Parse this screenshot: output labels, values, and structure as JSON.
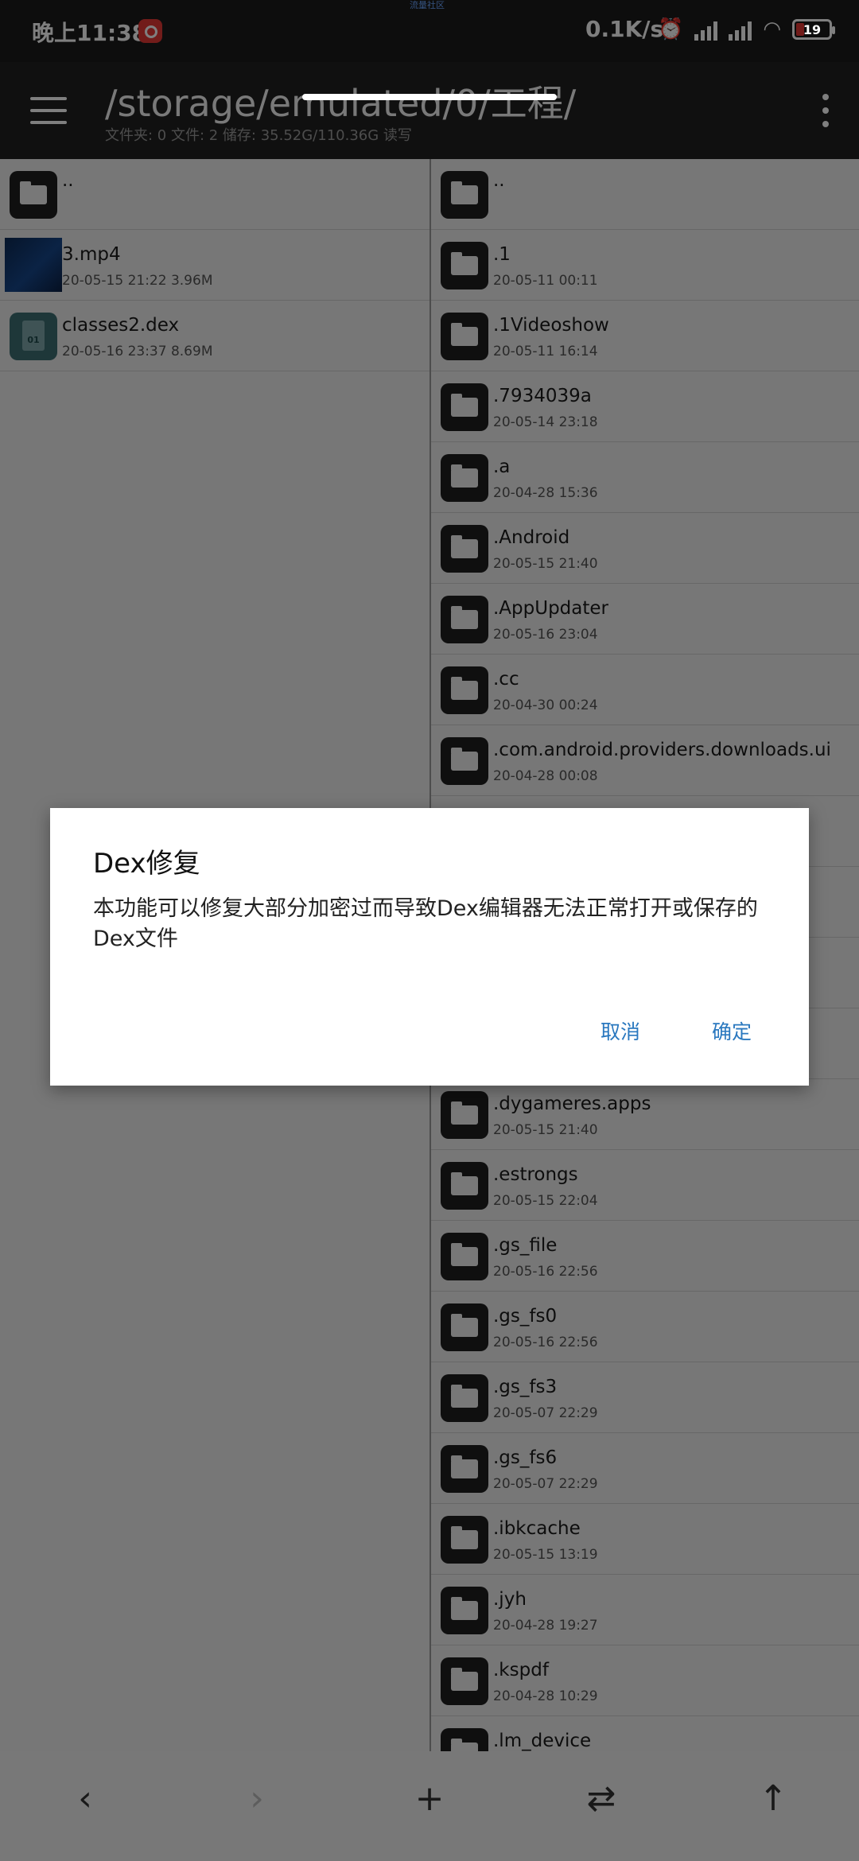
{
  "status_bar": {
    "time": "晚上11:38",
    "top_label": "流量社区",
    "speed": "0.1K/s",
    "battery": "19"
  },
  "header": {
    "path": "/storage/emulated/0/工程/",
    "info": "文件夹: 0  文件: 2  储存: 35.52G/110.36G  读写"
  },
  "left_panel": {
    "items": [
      {
        "name": "..",
        "meta": "",
        "icon": "folder"
      },
      {
        "name": "3.mp4",
        "meta": "20-05-15 21:22  3.96M",
        "icon": "video"
      },
      {
        "name": "classes2.dex",
        "meta": "20-05-16 23:37  8.69M",
        "icon": "dex"
      }
    ]
  },
  "right_panel": {
    "items": [
      {
        "name": "..",
        "meta": ""
      },
      {
        "name": ".1",
        "meta": "20-05-11 00:11"
      },
      {
        "name": ".1Videoshow",
        "meta": "20-05-11 16:14"
      },
      {
        "name": ".7934039a",
        "meta": "20-05-14 23:18"
      },
      {
        "name": ".a",
        "meta": "20-04-28 15:36"
      },
      {
        "name": ".Android",
        "meta": "20-05-15 21:40"
      },
      {
        "name": ".AppUpdater",
        "meta": "20-05-16 23:04"
      },
      {
        "name": ".cc",
        "meta": "20-04-30 00:24"
      },
      {
        "name": ".com.android.providers.downloads.ui",
        "meta": "20-04-28 00:08"
      },
      {
        "name": "",
        "meta": ""
      },
      {
        "name": "",
        "meta": ""
      },
      {
        "name": "",
        "meta": ""
      },
      {
        "name": "",
        "meta": ""
      },
      {
        "name": ".dygameres.apps",
        "meta": "20-05-15 21:40"
      },
      {
        "name": ".estrongs",
        "meta": "20-05-15 22:04"
      },
      {
        "name": ".gs_file",
        "meta": "20-05-16 22:56"
      },
      {
        "name": ".gs_fs0",
        "meta": "20-05-16 22:56"
      },
      {
        "name": ".gs_fs3",
        "meta": "20-05-07 22:29"
      },
      {
        "name": ".gs_fs6",
        "meta": "20-05-07 22:29"
      },
      {
        "name": ".ibkcache",
        "meta": "20-05-15 13:19"
      },
      {
        "name": ".jyh",
        "meta": "20-04-28 19:27"
      },
      {
        "name": ".kspdf",
        "meta": "20-04-28 10:29"
      },
      {
        "name": ".lm_device",
        "meta": ""
      }
    ]
  },
  "toolbar": {
    "back": "‹",
    "forward": "›",
    "add": "+",
    "swap": "⇄",
    "up": "↑"
  },
  "dialog": {
    "title": "Dex修复",
    "message": "本功能可以修复大部分加密过而导致Dex编辑器无法正常打开或保存的Dex文件",
    "cancel": "取消",
    "ok": "确定"
  }
}
